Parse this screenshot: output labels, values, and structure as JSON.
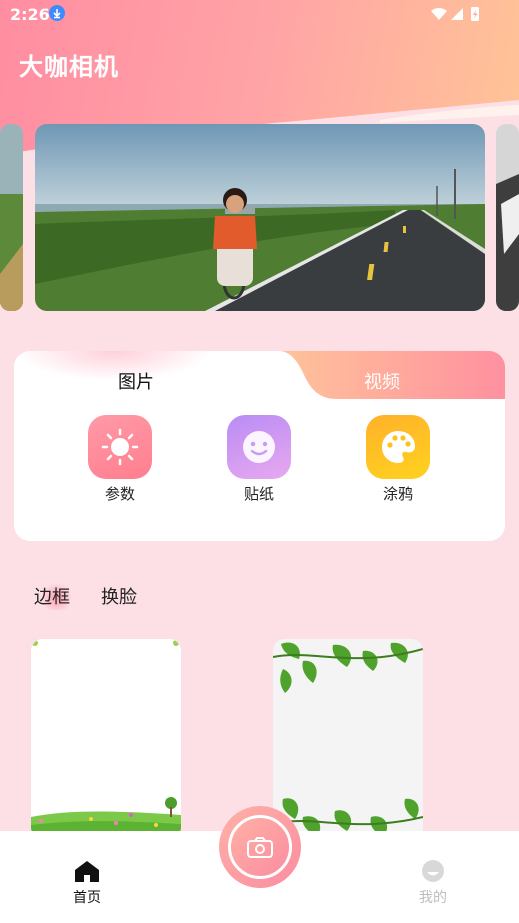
{
  "status_bar": {
    "time": "2:26"
  },
  "app": {
    "title": "大咖相机"
  },
  "tabs": {
    "photo": "图片",
    "video": "视频",
    "active": "图片"
  },
  "tools": [
    {
      "label": "参数",
      "icon": "sun-icon",
      "color": "#ff8e99"
    },
    {
      "label": "贴纸",
      "icon": "smiley-icon",
      "color": "#c79af7"
    },
    {
      "label": "涂鸦",
      "icon": "palette-icon",
      "color": "#ffc21a"
    }
  ],
  "sub_tabs": {
    "frame": "边框",
    "face_swap": "换脸",
    "active": "边框"
  },
  "bottom_nav": {
    "home": "首页",
    "mine": "我的"
  },
  "colors": {
    "accent": "#fb8da0",
    "background": "#fde0e6"
  }
}
